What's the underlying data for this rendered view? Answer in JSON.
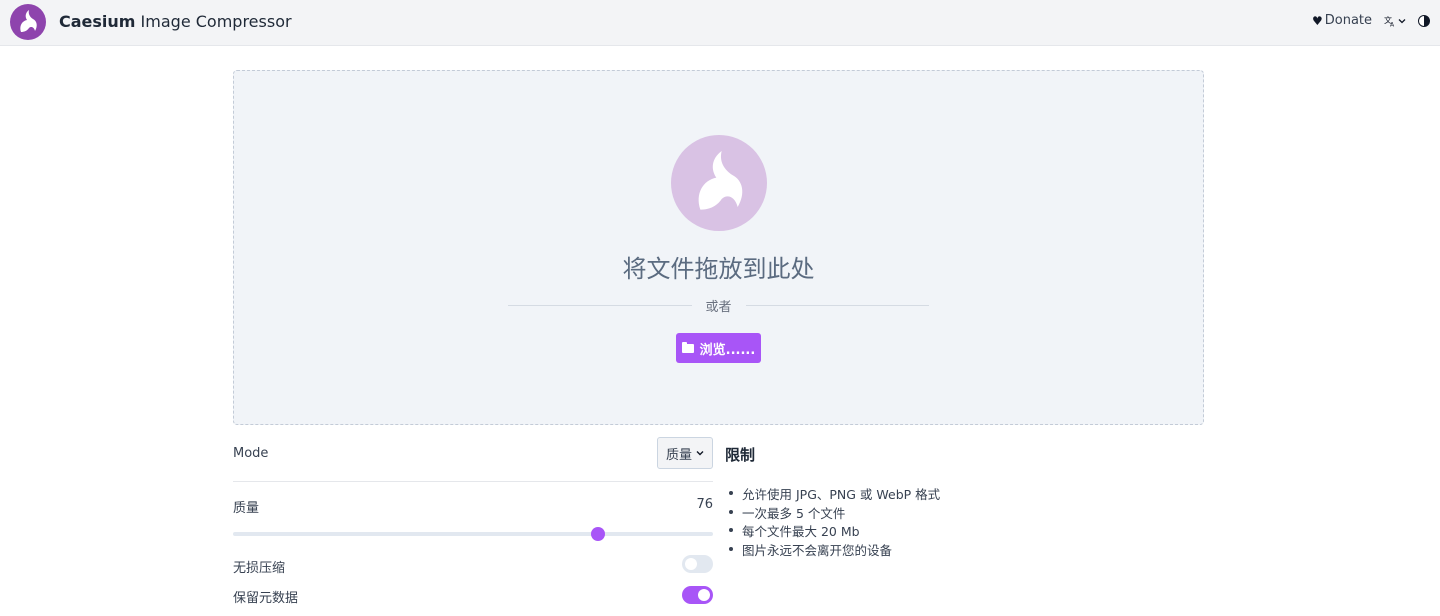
{
  "header": {
    "brand": "Caesium",
    "title_rest": " Image Compressor",
    "donate_label": "Donate",
    "language_icon": "translate-icon",
    "theme_icon": "contrast-icon"
  },
  "dropzone": {
    "title": "将文件拖放到此处",
    "or_label": "或者",
    "browse_label": "浏览......"
  },
  "settings": {
    "mode_label": "Mode",
    "mode_selected": "质量",
    "quality_label": "质量",
    "quality_value": "76",
    "quality_fraction": 0.76,
    "lossless_label": "无损压缩",
    "lossless_on": false,
    "metadata_label": "保留元数据",
    "metadata_on": true
  },
  "limits": {
    "title": "限制",
    "items": [
      "允许使用 JPG、PNG 或 WebP 格式",
      "一次最多 5 个文件",
      "每个文件最大 20 Mb",
      "图片永远不会离开您的设备"
    ]
  },
  "colors": {
    "accent": "#a855f7",
    "logo": "#8e44ad",
    "logo_light": "#d9c2e4"
  }
}
